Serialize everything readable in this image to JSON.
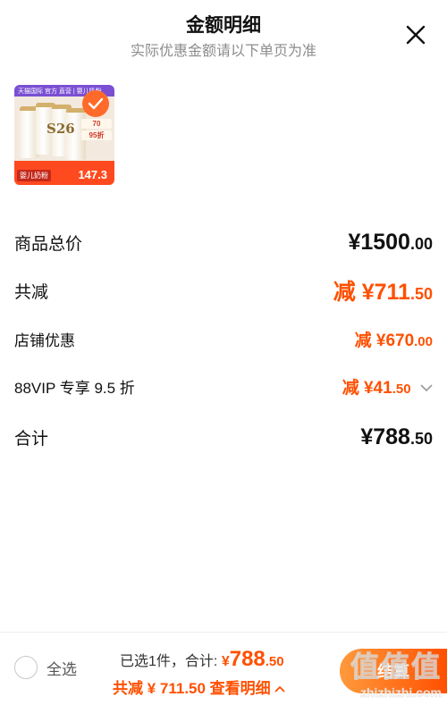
{
  "header": {
    "title": "金额明细",
    "subtitle": "实际优惠金额请以下单页为准"
  },
  "product": {
    "top_banner": "天猫国际 官方 直营 | 婴儿奶粉",
    "brand_label": "S26",
    "side_tags": [
      "70",
      "95折"
    ],
    "price": "147.3",
    "bottom_tag": "婴儿奶粉"
  },
  "rows": {
    "total_goods": {
      "label": "商品总价",
      "currency": "¥",
      "integer": "1500",
      "decimal": ".00"
    },
    "total_discount": {
      "label": "共减",
      "prefix": "减 ¥",
      "integer": "711",
      "decimal": ".50"
    },
    "shop_discount": {
      "label": "店铺优惠",
      "prefix": "减 ¥",
      "integer": "670",
      "decimal": ".00"
    },
    "vip_discount": {
      "label": "88VIP 专享 9.5 折",
      "prefix": "减 ¥",
      "integer": "41",
      "decimal": ".50"
    },
    "grand_total": {
      "label": "合计",
      "currency": "¥",
      "integer": "788",
      "decimal": ".50"
    }
  },
  "bottom_bar": {
    "select_all": "全选",
    "selected_text": "已选1件，合计:",
    "total_currency": "¥",
    "total_integer": "788",
    "total_decimal": ".50",
    "discount_text": "共减 ¥ 711.50 查看明细",
    "checkout": "结算"
  },
  "watermark": {
    "line1": "值值值",
    "line2": "zhizhizhi.com"
  },
  "colors": {
    "accent": "#ff5000",
    "muted": "#8c8c8c"
  }
}
